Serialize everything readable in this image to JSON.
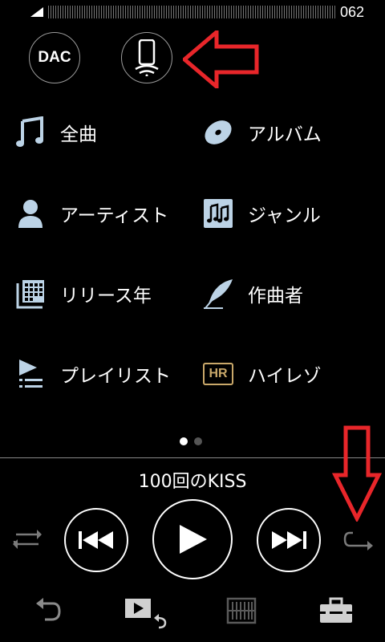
{
  "status": {
    "volume": "062"
  },
  "output": {
    "dac_label": "DAC"
  },
  "menu": [
    {
      "label": "全曲",
      "icon": "music-note-icon"
    },
    {
      "label": "アルバム",
      "icon": "disc-icon"
    },
    {
      "label": "アーティスト",
      "icon": "person-icon"
    },
    {
      "label": "ジャンル",
      "icon": "genre-notes-icon"
    },
    {
      "label": "リリース年",
      "icon": "calendar-icon"
    },
    {
      "label": "作曲者",
      "icon": "quill-icon"
    },
    {
      "label": "プレイリスト",
      "icon": "playlist-icon"
    },
    {
      "label": "ハイレゾ",
      "icon": "hr-icon"
    }
  ],
  "hr_badge": "HR",
  "player": {
    "title": "100回のKISS"
  },
  "colors": {
    "accent_red": "#e8262a",
    "icon_blue": "#bcd3e6",
    "hr_gold": "#c9a86a"
  }
}
